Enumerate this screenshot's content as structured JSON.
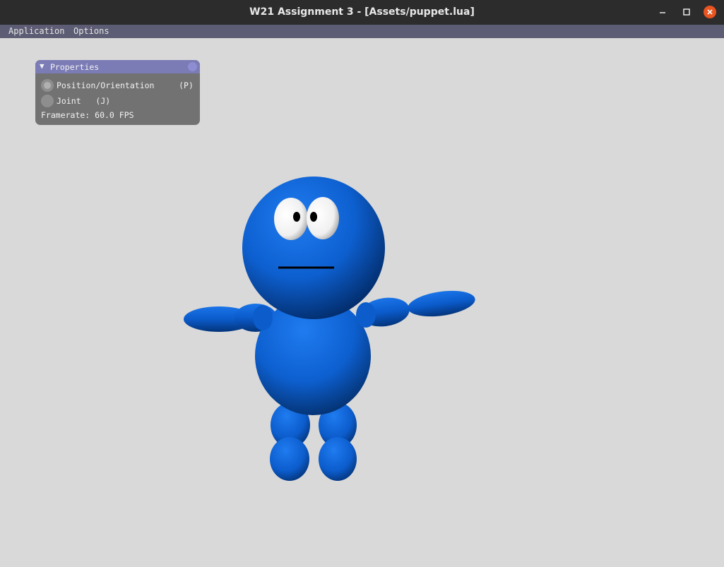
{
  "window": {
    "title": "W21 Assignment 3 - [Assets/puppet.lua]",
    "close_color": "#e95420"
  },
  "menubar": {
    "items": [
      "Application",
      "Options"
    ]
  },
  "properties_panel": {
    "title": "Properties",
    "collapse_arrow": "▼",
    "options": [
      {
        "label": "Position/Orientation",
        "shortcut": "(P)",
        "selected": true
      },
      {
        "label": "Joint",
        "shortcut": "(J)",
        "selected": false
      }
    ],
    "framerate_label": "Framerate: 60.0 FPS"
  },
  "viewport": {
    "background": "#d9d9d9",
    "puppet_color": "#1a66cc",
    "eye_color": "#ffffff",
    "pupil_color": "#000000"
  }
}
